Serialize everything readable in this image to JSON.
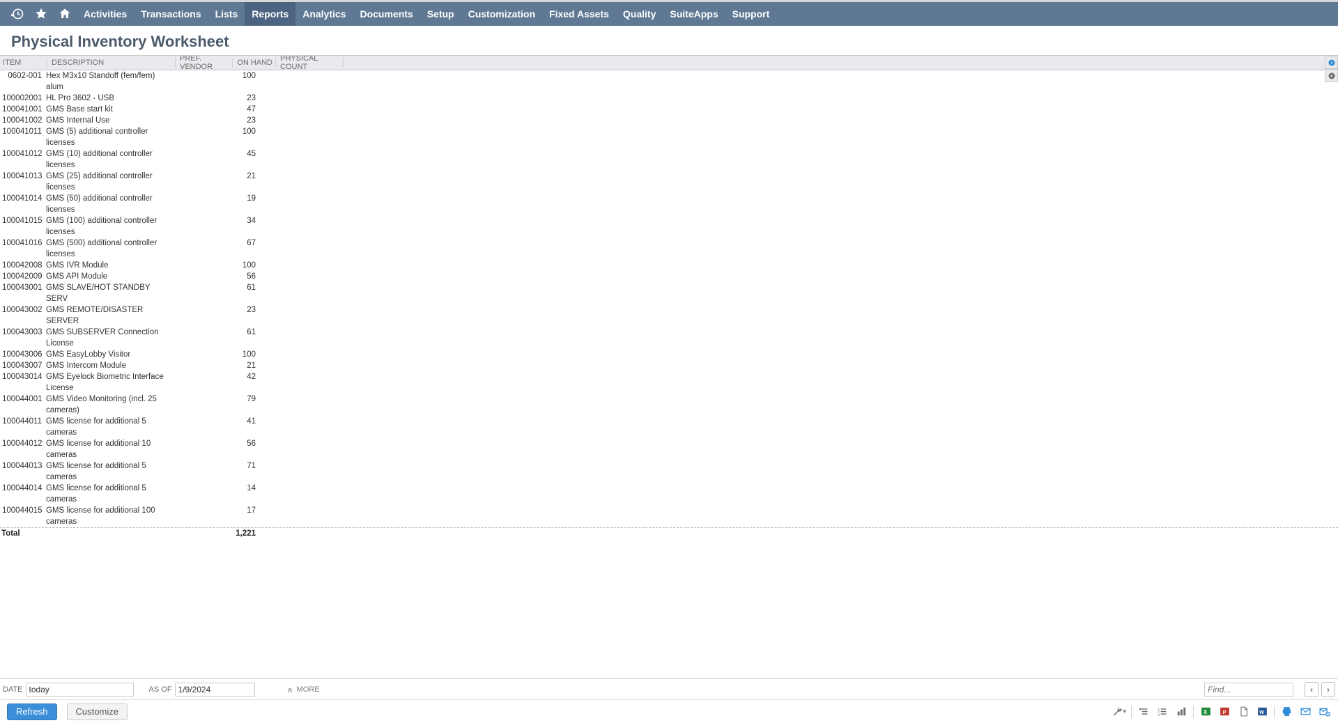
{
  "nav": {
    "items": [
      "Activities",
      "Transactions",
      "Lists",
      "Reports",
      "Analytics",
      "Documents",
      "Setup",
      "Customization",
      "Fixed Assets",
      "Quality",
      "SuiteApps",
      "Support"
    ],
    "active_index": 3
  },
  "page": {
    "title": "Physical Inventory Worksheet"
  },
  "table": {
    "headers": {
      "item": "ITEM",
      "description": "DESCRIPTION",
      "vendor": "PREF. VENDOR",
      "onhand": "ON HAND",
      "count": "PHYSICAL COUNT"
    },
    "rows": [
      {
        "item": "0602-001",
        "description": "Hex M3x10 Standoff (fem/fem) alum",
        "vendor": "",
        "onhand": "100",
        "count": ""
      },
      {
        "item": "100002001",
        "description": "HL Pro 3602 - USB",
        "vendor": "",
        "onhand": "23",
        "count": ""
      },
      {
        "item": "100041001",
        "description": "GMS Base start kit",
        "vendor": "",
        "onhand": "47",
        "count": ""
      },
      {
        "item": "100041002",
        "description": "GMS Internal Use",
        "vendor": "",
        "onhand": "23",
        "count": ""
      },
      {
        "item": "100041011",
        "description": "GMS (5) additional controller licenses",
        "vendor": "",
        "onhand": "100",
        "count": ""
      },
      {
        "item": "100041012",
        "description": "GMS (10) additional controller licenses",
        "vendor": "",
        "onhand": "45",
        "count": ""
      },
      {
        "item": "100041013",
        "description": "GMS (25) additional controller licenses",
        "vendor": "",
        "onhand": "21",
        "count": ""
      },
      {
        "item": "100041014",
        "description": "GMS (50) additional controller licenses",
        "vendor": "",
        "onhand": "19",
        "count": ""
      },
      {
        "item": "100041015",
        "description": "GMS (100) additional controller licenses",
        "vendor": "",
        "onhand": "34",
        "count": ""
      },
      {
        "item": "100041016",
        "description": "GMS (500) additional controller licenses",
        "vendor": "",
        "onhand": "67",
        "count": ""
      },
      {
        "item": "100042008",
        "description": "GMS IVR Module",
        "vendor": "",
        "onhand": "100",
        "count": ""
      },
      {
        "item": "100042009",
        "description": "GMS API Module",
        "vendor": "",
        "onhand": "56",
        "count": ""
      },
      {
        "item": "100043001",
        "description": "GMS SLAVE/HOT STANDBY SERV",
        "vendor": "",
        "onhand": "61",
        "count": ""
      },
      {
        "item": "100043002",
        "description": "GMS REMOTE/DISASTER SERVER",
        "vendor": "",
        "onhand": "23",
        "count": ""
      },
      {
        "item": "100043003",
        "description": "GMS SUBSERVER Connection License",
        "vendor": "",
        "onhand": "61",
        "count": ""
      },
      {
        "item": "100043006",
        "description": "GMS EasyLobby Visitor",
        "vendor": "",
        "onhand": "100",
        "count": ""
      },
      {
        "item": "100043007",
        "description": "GMS Intercom Module",
        "vendor": "",
        "onhand": "21",
        "count": ""
      },
      {
        "item": "100043014",
        "description": "GMS Eyelock Biometric Interface License",
        "vendor": "",
        "onhand": "42",
        "count": ""
      },
      {
        "item": "100044001",
        "description": "GMS Video Monitoring (incl. 25 cameras)",
        "vendor": "",
        "onhand": "79",
        "count": ""
      },
      {
        "item": "100044011",
        "description": "GMS license for additional 5 cameras",
        "vendor": "",
        "onhand": "41",
        "count": ""
      },
      {
        "item": "100044012",
        "description": "GMS license for additional 10 cameras",
        "vendor": "",
        "onhand": "56",
        "count": ""
      },
      {
        "item": "100044013",
        "description": "GMS license for additional 5 cameras",
        "vendor": "",
        "onhand": "71",
        "count": ""
      },
      {
        "item": "100044014",
        "description": "GMS license for additional 5 cameras",
        "vendor": "",
        "onhand": "14",
        "count": ""
      },
      {
        "item": "100044015",
        "description": "GMS license for additional 100 cameras",
        "vendor": "",
        "onhand": "17",
        "count": ""
      }
    ],
    "total_label": "Total",
    "total_onhand": "1,221"
  },
  "filters": {
    "date_label": "DATE",
    "date_value": "today",
    "asof_label": "AS OF",
    "asof_value": "1/9/2024",
    "more_label": "MORE",
    "find_placeholder": "Find..."
  },
  "actions": {
    "refresh": "Refresh",
    "customize": "Customize"
  }
}
